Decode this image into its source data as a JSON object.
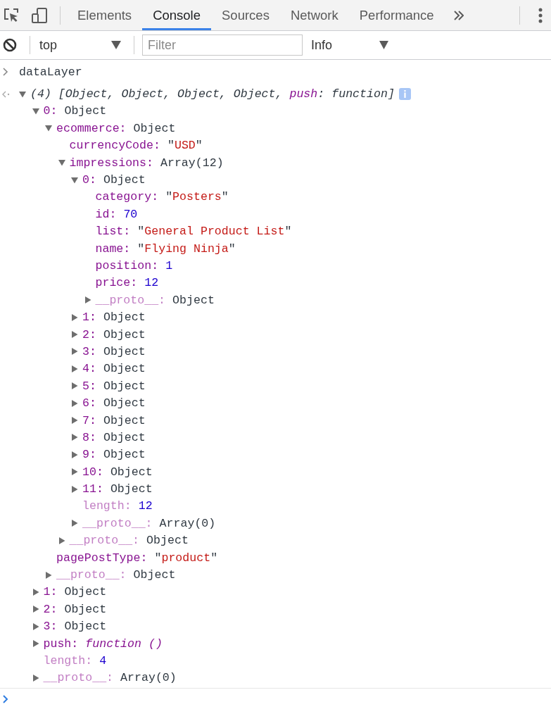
{
  "toolbar": {
    "tabs": [
      {
        "label": "Elements",
        "selected": false
      },
      {
        "label": "Console",
        "selected": true
      },
      {
        "label": "Sources",
        "selected": false
      },
      {
        "label": "Network",
        "selected": false
      },
      {
        "label": "Performance",
        "selected": false
      }
    ]
  },
  "filter_bar": {
    "context": {
      "value": "top"
    },
    "filter": {
      "placeholder": "Filter"
    },
    "level": {
      "value": "Info"
    }
  },
  "console": {
    "entries": [
      {
        "kind": "input",
        "text": "dataLayer"
      },
      {
        "kind": "result",
        "expanded": true,
        "summary": [
          {
            "kind": "text",
            "text": "(4) [Object, Object, Object, Object, "
          },
          {
            "kind": "key",
            "text": "push"
          },
          {
            "kind": "text",
            "text": ": function]"
          }
        ],
        "children": [
          {
            "kind": "object",
            "key": "0:",
            "hidden": false,
            "value": "Object",
            "expanded": true,
            "children": [
              {
                "kind": "object",
                "key": "ecommerce:",
                "hidden": false,
                "value": "Object",
                "expanded": true,
                "children": [
                  {
                    "kind": "string",
                    "key": "currencyCode:",
                    "hidden": false,
                    "value": "\"USD\""
                  },
                  {
                    "kind": "object",
                    "key": "impressions:",
                    "hidden": false,
                    "value": "Array(12)",
                    "expanded": true,
                    "children": [
                      {
                        "kind": "object",
                        "key": "0:",
                        "hidden": false,
                        "value": "Object",
                        "expanded": true,
                        "children": [
                          {
                            "kind": "string",
                            "key": "category:",
                            "hidden": false,
                            "value": "\"Posters\""
                          },
                          {
                            "kind": "number",
                            "key": "id:",
                            "hidden": false,
                            "value": "70"
                          },
                          {
                            "kind": "string",
                            "key": "list:",
                            "hidden": false,
                            "value": "\"General Product List\""
                          },
                          {
                            "kind": "string",
                            "key": "name:",
                            "hidden": false,
                            "value": "\"Flying Ninja\""
                          },
                          {
                            "kind": "number",
                            "key": "position:",
                            "hidden": false,
                            "value": "1"
                          },
                          {
                            "kind": "number",
                            "key": "price:",
                            "hidden": false,
                            "value": "12"
                          },
                          {
                            "kind": "object",
                            "key": "__proto__:",
                            "hidden": true,
                            "value": "Object",
                            "expanded": false
                          }
                        ]
                      },
                      {
                        "kind": "object",
                        "key": "1:",
                        "hidden": false,
                        "value": "Object",
                        "expanded": false
                      },
                      {
                        "kind": "object",
                        "key": "2:",
                        "hidden": false,
                        "value": "Object",
                        "expanded": false
                      },
                      {
                        "kind": "object",
                        "key": "3:",
                        "hidden": false,
                        "value": "Object",
                        "expanded": false
                      },
                      {
                        "kind": "object",
                        "key": "4:",
                        "hidden": false,
                        "value": "Object",
                        "expanded": false
                      },
                      {
                        "kind": "object",
                        "key": "5:",
                        "hidden": false,
                        "value": "Object",
                        "expanded": false
                      },
                      {
                        "kind": "object",
                        "key": "6:",
                        "hidden": false,
                        "value": "Object",
                        "expanded": false
                      },
                      {
                        "kind": "object",
                        "key": "7:",
                        "hidden": false,
                        "value": "Object",
                        "expanded": false
                      },
                      {
                        "kind": "object",
                        "key": "8:",
                        "hidden": false,
                        "value": "Object",
                        "expanded": false
                      },
                      {
                        "kind": "object",
                        "key": "9:",
                        "hidden": false,
                        "value": "Object",
                        "expanded": false
                      },
                      {
                        "kind": "object",
                        "key": "10:",
                        "hidden": false,
                        "value": "Object",
                        "expanded": false
                      },
                      {
                        "kind": "object",
                        "key": "11:",
                        "hidden": false,
                        "value": "Object",
                        "expanded": false
                      },
                      {
                        "kind": "number",
                        "key": "length:",
                        "hidden": true,
                        "value": "12"
                      },
                      {
                        "kind": "object",
                        "key": "__proto__:",
                        "hidden": true,
                        "value": "Array(0)",
                        "expanded": false
                      }
                    ]
                  },
                  {
                    "kind": "object",
                    "key": "__proto__:",
                    "hidden": true,
                    "value": "Object",
                    "expanded": false
                  }
                ]
              },
              {
                "kind": "string",
                "key": "pagePostType:",
                "hidden": false,
                "value": "\"product\""
              },
              {
                "kind": "object",
                "key": "__proto__:",
                "hidden": true,
                "value": "Object",
                "expanded": false
              }
            ]
          },
          {
            "kind": "object",
            "key": "1:",
            "hidden": false,
            "value": "Object",
            "expanded": false
          },
          {
            "kind": "object",
            "key": "2:",
            "hidden": false,
            "value": "Object",
            "expanded": false
          },
          {
            "kind": "object",
            "key": "3:",
            "hidden": false,
            "value": "Object",
            "expanded": false
          },
          {
            "kind": "function",
            "key": "push:",
            "hidden": false,
            "value": "function ()",
            "expanded": false
          },
          {
            "kind": "number",
            "key": "length:",
            "hidden": true,
            "value": "4"
          },
          {
            "kind": "object",
            "key": "__proto__:",
            "hidden": true,
            "value": "Array(0)",
            "expanded": false
          }
        ]
      }
    ]
  }
}
